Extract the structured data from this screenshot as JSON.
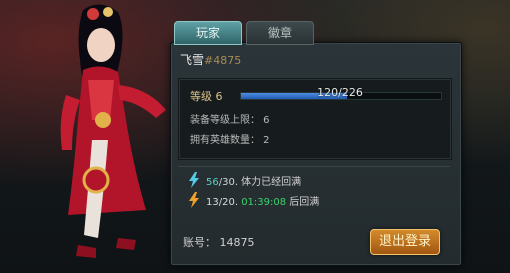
{
  "tabs": [
    {
      "label": "玩家"
    },
    {
      "label": "徽章"
    }
  ],
  "player": {
    "name": "飞雪",
    "id_text": "#4875"
  },
  "level": {
    "label": "等级 6",
    "xp_text": "120/226",
    "progress_fraction": 0.531
  },
  "stats": {
    "equip_cap": "装备等级上限： 6",
    "hero_count": "拥有英雄数量： 2"
  },
  "stamina": {
    "value": "56",
    "text": "/30. 体力已经回满"
  },
  "energy": {
    "value": "13/20.",
    "timer": "01:39:08",
    "suffix": "后回满"
  },
  "account": {
    "text": "账号： 14875"
  },
  "buttons": {
    "logout": "退出登录"
  },
  "colors": {
    "accent": "#5fa1a6",
    "xp_bar": "#4e8fe0",
    "button": "#d38a2b"
  }
}
